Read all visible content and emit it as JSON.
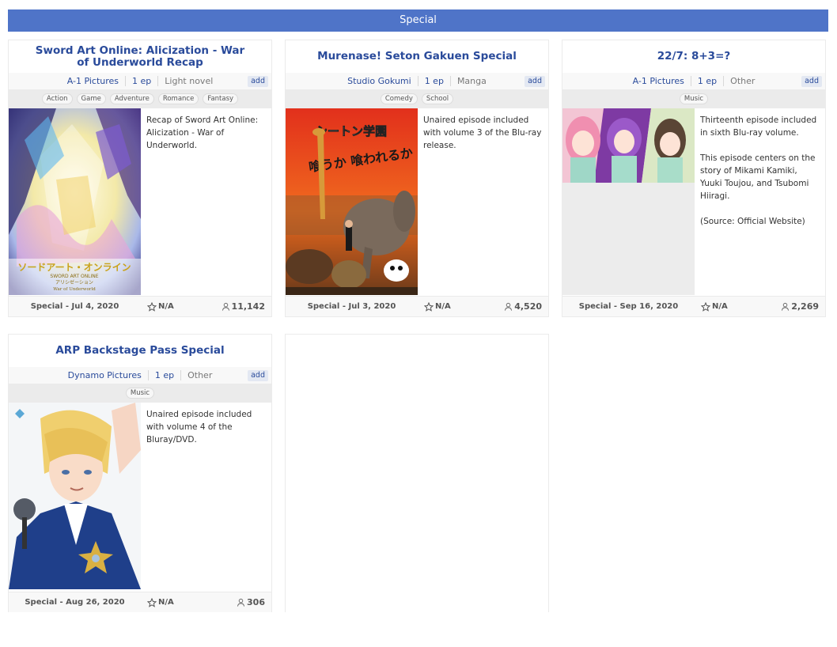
{
  "section": {
    "title": "Special"
  },
  "cards": [
    {
      "title": "Sword Art Online: Alicization - War of Underworld Recap",
      "studio": "A-1 Pictures",
      "episodes": "1 ep",
      "source": "Light novel",
      "add": "add",
      "genres": [
        "Action",
        "Game",
        "Adventure",
        "Romance",
        "Fantasy"
      ],
      "synopsis": [
        "Recap of Sword Art Online: Alicization - War of Underworld."
      ],
      "type_date": "Special - Jul 4, 2020",
      "score": "N/A",
      "members": "11,142"
    },
    {
      "title": "Murenase! Seton Gakuen Special",
      "studio": "Studio Gokumi",
      "episodes": "1 ep",
      "source": "Manga",
      "add": "add",
      "genres": [
        "Comedy",
        "School"
      ],
      "synopsis": [
        "Unaired episode included with volume 3 of the Blu-ray release."
      ],
      "type_date": "Special - Jul 3, 2020",
      "score": "N/A",
      "members": "4,520"
    },
    {
      "title": "22/7: 8+3=?",
      "studio": "A-1 Pictures",
      "episodes": "1 ep",
      "source": "Other",
      "add": "add",
      "genres": [
        "Music"
      ],
      "synopsis": [
        "Thirteenth episode included in sixth Blu-ray volume.",
        "This episode centers on the story of Mikami Kamiki, Yuuki Toujou, and Tsubomi Hiiragi.",
        "(Source: Official Website)"
      ],
      "type_date": "Special - Sep 16, 2020",
      "score": "N/A",
      "members": "2,269"
    },
    {
      "title": "ARP Backstage Pass Special",
      "studio": "Dynamo Pictures",
      "episodes": "1 ep",
      "source": "Other",
      "add": "add",
      "genres": [
        "Music"
      ],
      "synopsis": [
        "Unaired episode included with volume 4 of the Bluray/DVD."
      ],
      "type_date": "Special - Aug 26, 2020",
      "score": "N/A",
      "members": "306"
    }
  ],
  "poster_text": {
    "sao_logo_jp": "ソードアート・オンライン",
    "sao_logo_en": "SWORD ART ONLINE",
    "sao_logo_sub": "アリシゼーション",
    "sao_logo_wou": "War of Underworld",
    "seton_logo": "シートン学園",
    "seton_catch": "喰うか 喰われるか"
  },
  "icons": {
    "score": "star-outline-icon",
    "members": "user-icon"
  },
  "colors": {
    "header_bg": "#4f74c8",
    "title": "#2a4b9b"
  }
}
